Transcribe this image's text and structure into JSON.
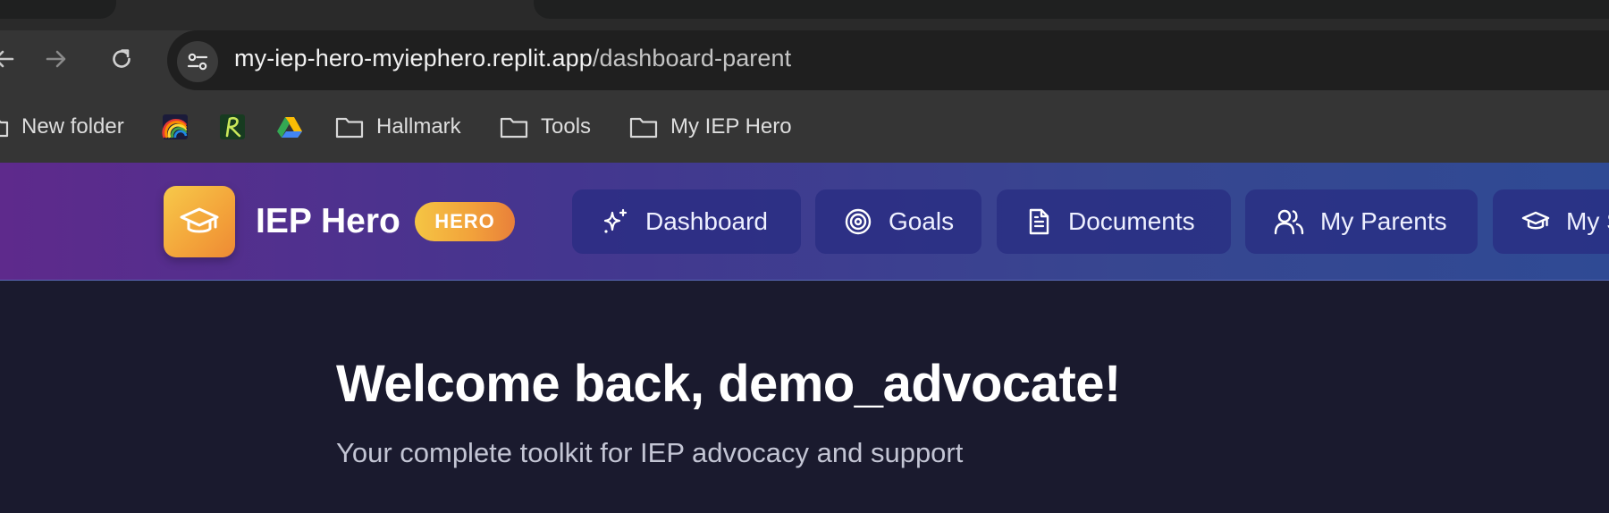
{
  "browser": {
    "url_host": "my-iep-hero-myiephero.replit.app",
    "url_path": "/dashboard-parent",
    "nav_icons": [
      "back-arrow-icon",
      "forward-arrow-icon",
      "reload-icon"
    ],
    "site_info_icon": "tune-icon",
    "bookmarks": [
      {
        "label": "New folder",
        "icon": "folder-icon"
      },
      {
        "label": "",
        "icon": "rainbow-favicon"
      },
      {
        "label": "",
        "icon": "green-r-favicon"
      },
      {
        "label": "",
        "icon": "google-drive-icon"
      },
      {
        "label": "Hallmark",
        "icon": "folder-icon"
      },
      {
        "label": "Tools",
        "icon": "folder-icon"
      },
      {
        "label": "My IEP Hero",
        "icon": "folder-icon"
      }
    ]
  },
  "header": {
    "logo_icon": "graduation-cap-icon",
    "brand": "IEP Hero",
    "badge": "HERO",
    "nav": [
      {
        "label": "Dashboard",
        "icon": "sparkles-icon"
      },
      {
        "label": "Goals",
        "icon": "target-icon"
      },
      {
        "label": "Documents",
        "icon": "document-icon"
      },
      {
        "label": "My Parents",
        "icon": "users-icon"
      },
      {
        "label": "My S",
        "icon": "graduation-cap-icon"
      }
    ]
  },
  "main": {
    "welcome": "Welcome back, demo_advocate!",
    "subtitle": "Your complete toolkit for IEP advocacy and support"
  },
  "colors": {
    "page_bg": "#1a1a2e",
    "header_gradient_start": "#5e2a8c",
    "header_gradient_end": "#2f4a94",
    "accent_orange": "#f3a33a",
    "accent_yellow": "#f7c94a"
  }
}
